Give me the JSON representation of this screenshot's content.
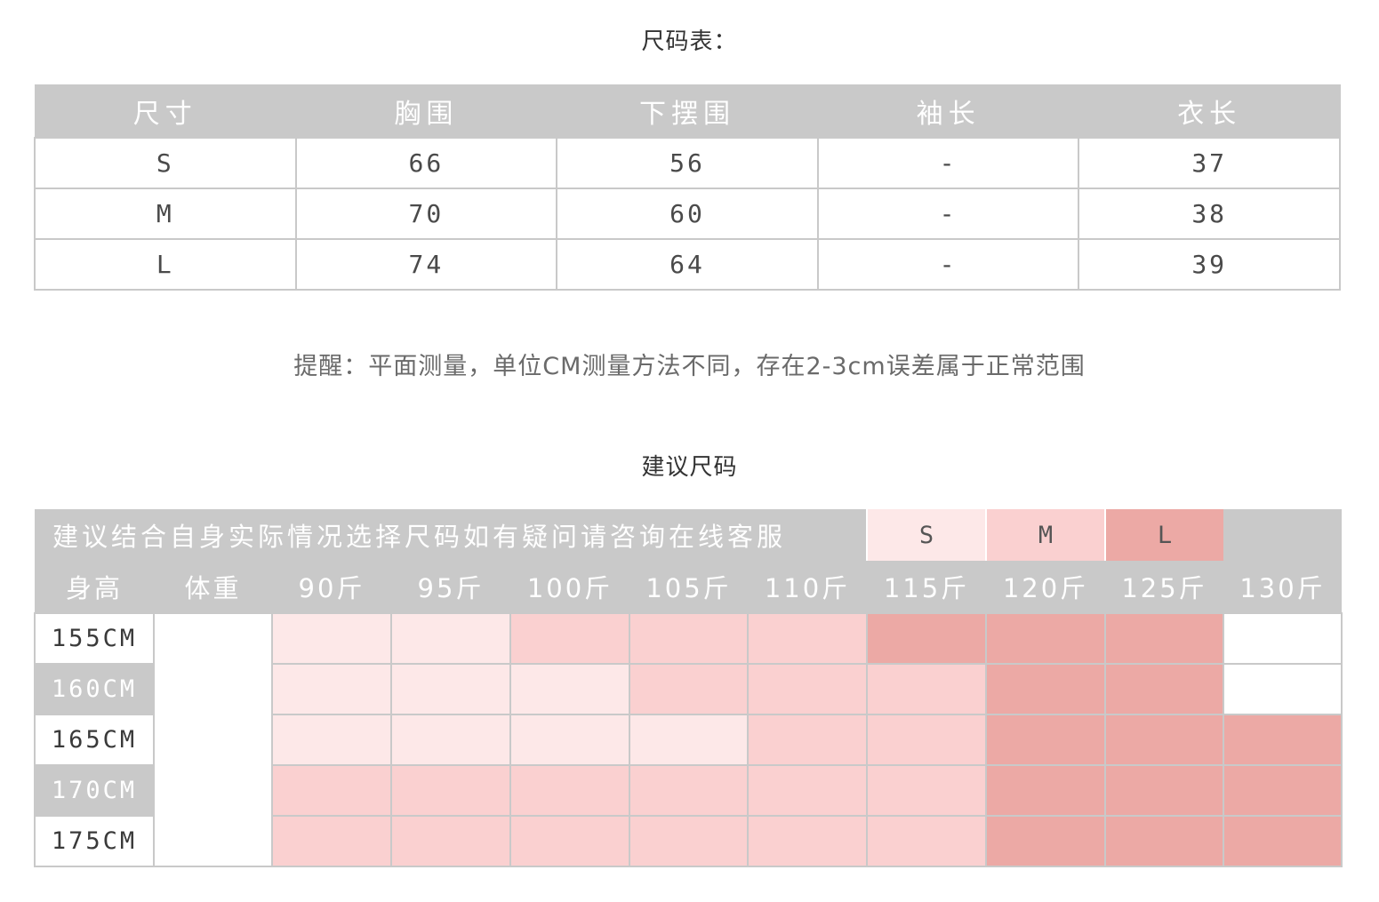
{
  "size_chart": {
    "title": "尺码表：",
    "headers": [
      "尺寸",
      "胸围",
      "下摆围",
      "袖长",
      "衣长"
    ],
    "rows": [
      [
        "S",
        "66",
        "56",
        "-",
        "37"
      ],
      [
        "M",
        "70",
        "60",
        "-",
        "38"
      ],
      [
        "L",
        "74",
        "64",
        "-",
        "39"
      ]
    ]
  },
  "note": "提醒：平面测量，单位CM测量方法不同，存在2-3cm误差属于正常范围",
  "recommendation": {
    "title": "建议尺码",
    "banner": "建议结合自身实际情况选择尺码如有疑问请咨询在线客服",
    "legend": [
      {
        "label": "S",
        "color": "#fde8e8"
      },
      {
        "label": "M",
        "color": "#fad0d0"
      },
      {
        "label": "L",
        "color": "#eca9a5"
      }
    ],
    "height_header": "身高",
    "weight_header": "体重",
    "weights": [
      "90斤",
      "95斤",
      "100斤",
      "105斤",
      "110斤",
      "115斤",
      "120斤",
      "125斤",
      "130斤"
    ],
    "heights": [
      "155CM",
      "160CM",
      "165CM",
      "170CM",
      "175CM"
    ],
    "colors": {
      "S": "#fde8e8",
      "M": "#fad0d0",
      "L": "#eca9a5",
      "none": "#ffffff",
      "grey": "#c9c9c9"
    },
    "grid": [
      [
        "S",
        "S",
        "M",
        "M",
        "M",
        "L",
        "L",
        "L",
        "none"
      ],
      [
        "S",
        "S",
        "S",
        "M",
        "M",
        "M",
        "L",
        "L",
        "none"
      ],
      [
        "S",
        "S",
        "S",
        "S",
        "M",
        "M",
        "L",
        "L",
        "L"
      ],
      [
        "M",
        "M",
        "M",
        "M",
        "M",
        "M",
        "L",
        "L",
        "L"
      ],
      [
        "M",
        "M",
        "M",
        "M",
        "M",
        "M",
        "L",
        "L",
        "L"
      ]
    ]
  }
}
